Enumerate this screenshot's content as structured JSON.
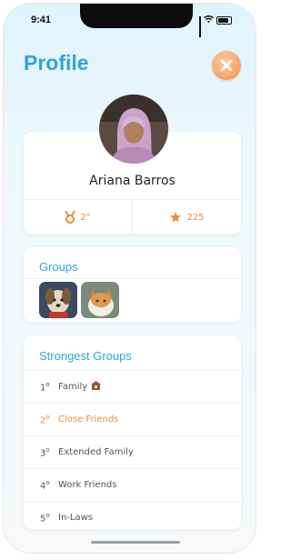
{
  "status_bar": {
    "time": "9:41"
  },
  "header": {
    "title": "Profile"
  },
  "profile": {
    "name": "Ariana Barros",
    "medal_value": "2°",
    "star_value": "225"
  },
  "groups": {
    "title": "Groups",
    "thumbnails": [
      "dog-thumbnail",
      "cat-thumbnail"
    ]
  },
  "strongest_groups": {
    "title": "Strongest Groups",
    "items": [
      {
        "rank": "1",
        "ordinal": "o",
        "label": "Family",
        "active": false
      },
      {
        "rank": "2",
        "ordinal": "o",
        "label": "Close Friends",
        "active": true
      },
      {
        "rank": "3",
        "ordinal": "o",
        "label": "Extended Family",
        "active": false
      },
      {
        "rank": "4",
        "ordinal": "o",
        "label": "Work Friends",
        "active": false
      },
      {
        "rank": "5",
        "ordinal": "o",
        "label": "In-Laws",
        "active": false
      }
    ]
  },
  "colors": {
    "accent_blue": "#2fa4df",
    "accent_orange": "#f08a3a"
  }
}
